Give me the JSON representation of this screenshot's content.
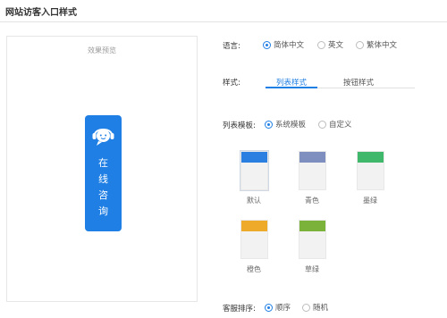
{
  "header": {
    "title": "网站访客入口样式"
  },
  "preview": {
    "label": "效果预览",
    "button_chars": [
      "在",
      "线",
      "咨",
      "询"
    ],
    "button_color": "#1f7fe4",
    "icon": "headset-chat-icon"
  },
  "language": {
    "label": "语言:",
    "options": [
      {
        "label": "简体中文",
        "selected": true
      },
      {
        "label": "英文",
        "selected": false
      },
      {
        "label": "繁体中文",
        "selected": false
      }
    ]
  },
  "style": {
    "label": "样式:",
    "tabs": [
      {
        "label": "列表样式",
        "active": true
      },
      {
        "label": "按钮样式",
        "active": false
      }
    ]
  },
  "list_template": {
    "label": "列表模板:",
    "options": [
      {
        "label": "系统模板",
        "selected": true
      },
      {
        "label": "自定义",
        "selected": false
      }
    ],
    "swatches": [
      {
        "label": "默认",
        "color": "#2b7fe0",
        "selected": true
      },
      {
        "label": "青色",
        "color": "#7e8fbf",
        "selected": false
      },
      {
        "label": "墨绿",
        "color": "#3fb86b",
        "selected": false
      },
      {
        "label": "橙色",
        "color": "#eeaa2b",
        "selected": false
      },
      {
        "label": "草绿",
        "color": "#7bb23a",
        "selected": false
      }
    ]
  },
  "service_order": {
    "label": "客服排序:",
    "options": [
      {
        "label": "顺序",
        "selected": true
      },
      {
        "label": "随机",
        "selected": false
      }
    ]
  },
  "colors": {
    "accent": "#1f7fe4"
  }
}
